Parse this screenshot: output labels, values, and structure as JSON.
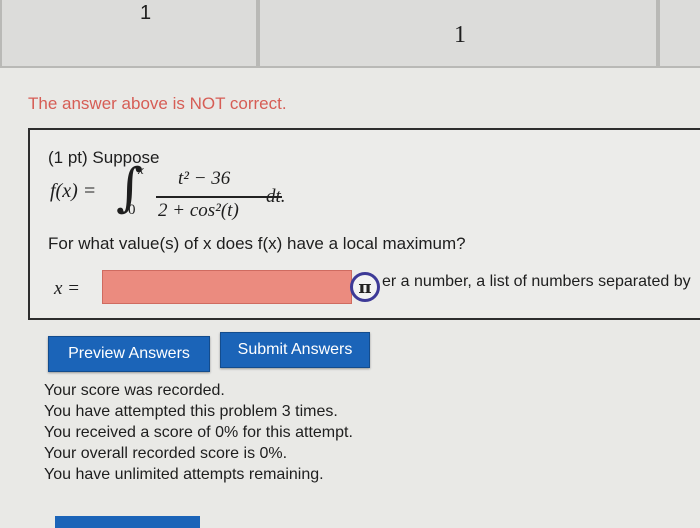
{
  "previous_table": {
    "cell1": "1",
    "cell2": "1"
  },
  "warning": "The answer above is NOT correct.",
  "problem": {
    "intro": "(1 pt) Suppose",
    "fx": "f(x) =",
    "upper_limit": "x",
    "lower_limit": "0",
    "numerator": "t² − 36",
    "denominator": "2 + cos²(t)",
    "differential": "dt.",
    "question": "For what value(s) of x does f(x) have a local maximum?",
    "answer_label": "x =",
    "answer_value": "",
    "hint": "er a number, a list of numbers separated by"
  },
  "buttons": {
    "preview": "Preview Answers",
    "submit": "Submit Answers"
  },
  "results": [
    "Your score was recorded.",
    "You have attempted this problem 3 times.",
    "You received a score of 0% for this attempt.",
    "Your overall recorded score is 0%.",
    "You have unlimited attempts remaining."
  ],
  "icons": {
    "pi": "π"
  },
  "colors": {
    "warning": "#d65d55",
    "button": "#1b64b8",
    "input_error": "#eb8b7f"
  }
}
